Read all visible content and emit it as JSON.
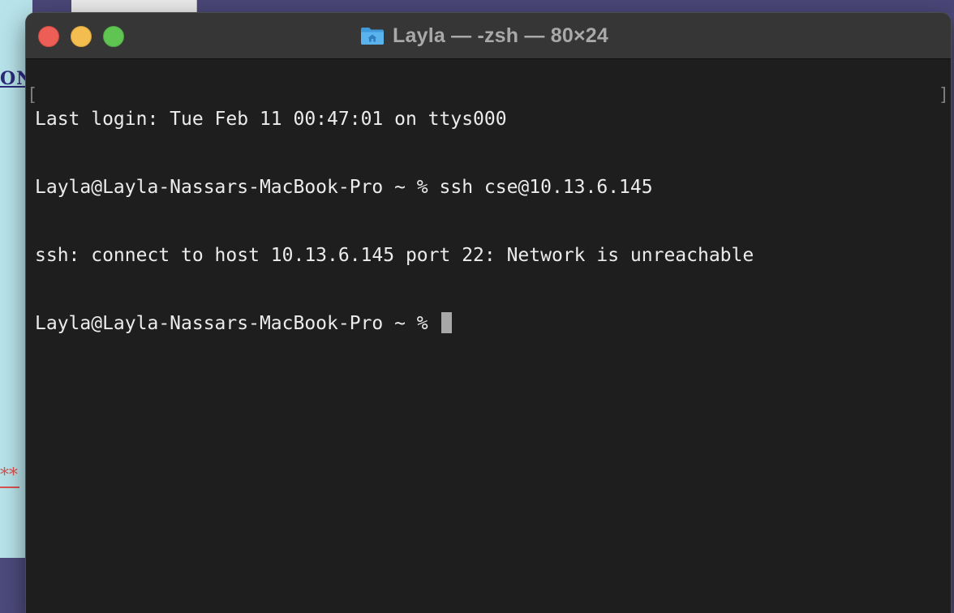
{
  "background": {
    "left_window_text": "ON",
    "left_window_stars": "**"
  },
  "window": {
    "title": "Layla — -zsh — 80×24",
    "title_icon": "home-folder-icon",
    "controls": {
      "close": "close-button",
      "minimize": "minimize-button",
      "zoom": "zoom-button"
    }
  },
  "terminal": {
    "lines": [
      "Last login: Tue Feb 11 00:47:01 on ttys000",
      "Layla@Layla-Nassars-MacBook-Pro ~ % ssh cse@10.13.6.145",
      "ssh: connect to host 10.13.6.145 port 22: Network is unreachable"
    ],
    "prompt": "Layla@Layla-Nassars-MacBook-Pro ~ % ",
    "mark_left": "[",
    "mark_right": "]"
  },
  "colors": {
    "terminal_bg": "#1e1e1e",
    "text": "#ececec",
    "close": "#ed5f56",
    "minimize": "#f4bd4f",
    "zoom": "#60c453"
  }
}
